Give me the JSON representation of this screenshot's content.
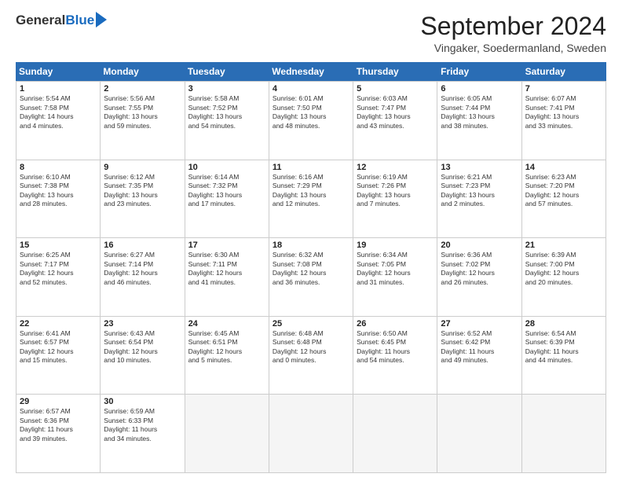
{
  "header": {
    "logo_general": "General",
    "logo_blue": "Blue",
    "month_title": "September 2024",
    "location": "Vingaker, Soedermanland, Sweden"
  },
  "weekdays": [
    "Sunday",
    "Monday",
    "Tuesday",
    "Wednesday",
    "Thursday",
    "Friday",
    "Saturday"
  ],
  "rows": [
    [
      {
        "day": "1",
        "lines": [
          "Sunrise: 5:54 AM",
          "Sunset: 7:58 PM",
          "Daylight: 14 hours",
          "and 4 minutes."
        ]
      },
      {
        "day": "2",
        "lines": [
          "Sunrise: 5:56 AM",
          "Sunset: 7:55 PM",
          "Daylight: 13 hours",
          "and 59 minutes."
        ]
      },
      {
        "day": "3",
        "lines": [
          "Sunrise: 5:58 AM",
          "Sunset: 7:52 PM",
          "Daylight: 13 hours",
          "and 54 minutes."
        ]
      },
      {
        "day": "4",
        "lines": [
          "Sunrise: 6:01 AM",
          "Sunset: 7:50 PM",
          "Daylight: 13 hours",
          "and 48 minutes."
        ]
      },
      {
        "day": "5",
        "lines": [
          "Sunrise: 6:03 AM",
          "Sunset: 7:47 PM",
          "Daylight: 13 hours",
          "and 43 minutes."
        ]
      },
      {
        "day": "6",
        "lines": [
          "Sunrise: 6:05 AM",
          "Sunset: 7:44 PM",
          "Daylight: 13 hours",
          "and 38 minutes."
        ]
      },
      {
        "day": "7",
        "lines": [
          "Sunrise: 6:07 AM",
          "Sunset: 7:41 PM",
          "Daylight: 13 hours",
          "and 33 minutes."
        ]
      }
    ],
    [
      {
        "day": "8",
        "lines": [
          "Sunrise: 6:10 AM",
          "Sunset: 7:38 PM",
          "Daylight: 13 hours",
          "and 28 minutes."
        ]
      },
      {
        "day": "9",
        "lines": [
          "Sunrise: 6:12 AM",
          "Sunset: 7:35 PM",
          "Daylight: 13 hours",
          "and 23 minutes."
        ]
      },
      {
        "day": "10",
        "lines": [
          "Sunrise: 6:14 AM",
          "Sunset: 7:32 PM",
          "Daylight: 13 hours",
          "and 17 minutes."
        ]
      },
      {
        "day": "11",
        "lines": [
          "Sunrise: 6:16 AM",
          "Sunset: 7:29 PM",
          "Daylight: 13 hours",
          "and 12 minutes."
        ]
      },
      {
        "day": "12",
        "lines": [
          "Sunrise: 6:19 AM",
          "Sunset: 7:26 PM",
          "Daylight: 13 hours",
          "and 7 minutes."
        ]
      },
      {
        "day": "13",
        "lines": [
          "Sunrise: 6:21 AM",
          "Sunset: 7:23 PM",
          "Daylight: 13 hours",
          "and 2 minutes."
        ]
      },
      {
        "day": "14",
        "lines": [
          "Sunrise: 6:23 AM",
          "Sunset: 7:20 PM",
          "Daylight: 12 hours",
          "and 57 minutes."
        ]
      }
    ],
    [
      {
        "day": "15",
        "lines": [
          "Sunrise: 6:25 AM",
          "Sunset: 7:17 PM",
          "Daylight: 12 hours",
          "and 52 minutes."
        ]
      },
      {
        "day": "16",
        "lines": [
          "Sunrise: 6:27 AM",
          "Sunset: 7:14 PM",
          "Daylight: 12 hours",
          "and 46 minutes."
        ]
      },
      {
        "day": "17",
        "lines": [
          "Sunrise: 6:30 AM",
          "Sunset: 7:11 PM",
          "Daylight: 12 hours",
          "and 41 minutes."
        ]
      },
      {
        "day": "18",
        "lines": [
          "Sunrise: 6:32 AM",
          "Sunset: 7:08 PM",
          "Daylight: 12 hours",
          "and 36 minutes."
        ]
      },
      {
        "day": "19",
        "lines": [
          "Sunrise: 6:34 AM",
          "Sunset: 7:05 PM",
          "Daylight: 12 hours",
          "and 31 minutes."
        ]
      },
      {
        "day": "20",
        "lines": [
          "Sunrise: 6:36 AM",
          "Sunset: 7:02 PM",
          "Daylight: 12 hours",
          "and 26 minutes."
        ]
      },
      {
        "day": "21",
        "lines": [
          "Sunrise: 6:39 AM",
          "Sunset: 7:00 PM",
          "Daylight: 12 hours",
          "and 20 minutes."
        ]
      }
    ],
    [
      {
        "day": "22",
        "lines": [
          "Sunrise: 6:41 AM",
          "Sunset: 6:57 PM",
          "Daylight: 12 hours",
          "and 15 minutes."
        ]
      },
      {
        "day": "23",
        "lines": [
          "Sunrise: 6:43 AM",
          "Sunset: 6:54 PM",
          "Daylight: 12 hours",
          "and 10 minutes."
        ]
      },
      {
        "day": "24",
        "lines": [
          "Sunrise: 6:45 AM",
          "Sunset: 6:51 PM",
          "Daylight: 12 hours",
          "and 5 minutes."
        ]
      },
      {
        "day": "25",
        "lines": [
          "Sunrise: 6:48 AM",
          "Sunset: 6:48 PM",
          "Daylight: 12 hours",
          "and 0 minutes."
        ]
      },
      {
        "day": "26",
        "lines": [
          "Sunrise: 6:50 AM",
          "Sunset: 6:45 PM",
          "Daylight: 11 hours",
          "and 54 minutes."
        ]
      },
      {
        "day": "27",
        "lines": [
          "Sunrise: 6:52 AM",
          "Sunset: 6:42 PM",
          "Daylight: 11 hours",
          "and 49 minutes."
        ]
      },
      {
        "day": "28",
        "lines": [
          "Sunrise: 6:54 AM",
          "Sunset: 6:39 PM",
          "Daylight: 11 hours",
          "and 44 minutes."
        ]
      }
    ],
    [
      {
        "day": "29",
        "lines": [
          "Sunrise: 6:57 AM",
          "Sunset: 6:36 PM",
          "Daylight: 11 hours",
          "and 39 minutes."
        ]
      },
      {
        "day": "30",
        "lines": [
          "Sunrise: 6:59 AM",
          "Sunset: 6:33 PM",
          "Daylight: 11 hours",
          "and 34 minutes."
        ]
      },
      {
        "day": "",
        "lines": []
      },
      {
        "day": "",
        "lines": []
      },
      {
        "day": "",
        "lines": []
      },
      {
        "day": "",
        "lines": []
      },
      {
        "day": "",
        "lines": []
      }
    ]
  ]
}
